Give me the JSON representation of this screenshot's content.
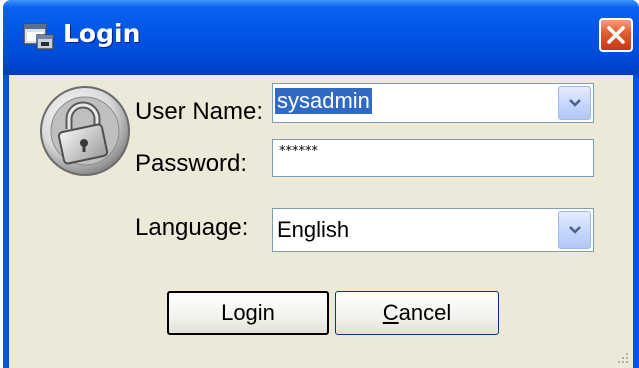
{
  "window": {
    "title": "Login"
  },
  "form": {
    "username_label": "User Name:",
    "username_value": "sysadmin",
    "password_label": "Password:",
    "password_value": "******",
    "language_label": "Language:",
    "language_value": "English"
  },
  "buttons": {
    "login": "Login",
    "cancel_prefix": "C",
    "cancel_rest": "ancel"
  },
  "icons": {
    "app": "app-window-icon",
    "lock": "padlock-icon",
    "close": "close-icon",
    "dropdown": "chevron-down-icon"
  },
  "colors": {
    "titlebar": "#0055e5",
    "client_bg": "#ece9d8",
    "close_button": "#e05a2a",
    "selection": "#316ac5"
  }
}
